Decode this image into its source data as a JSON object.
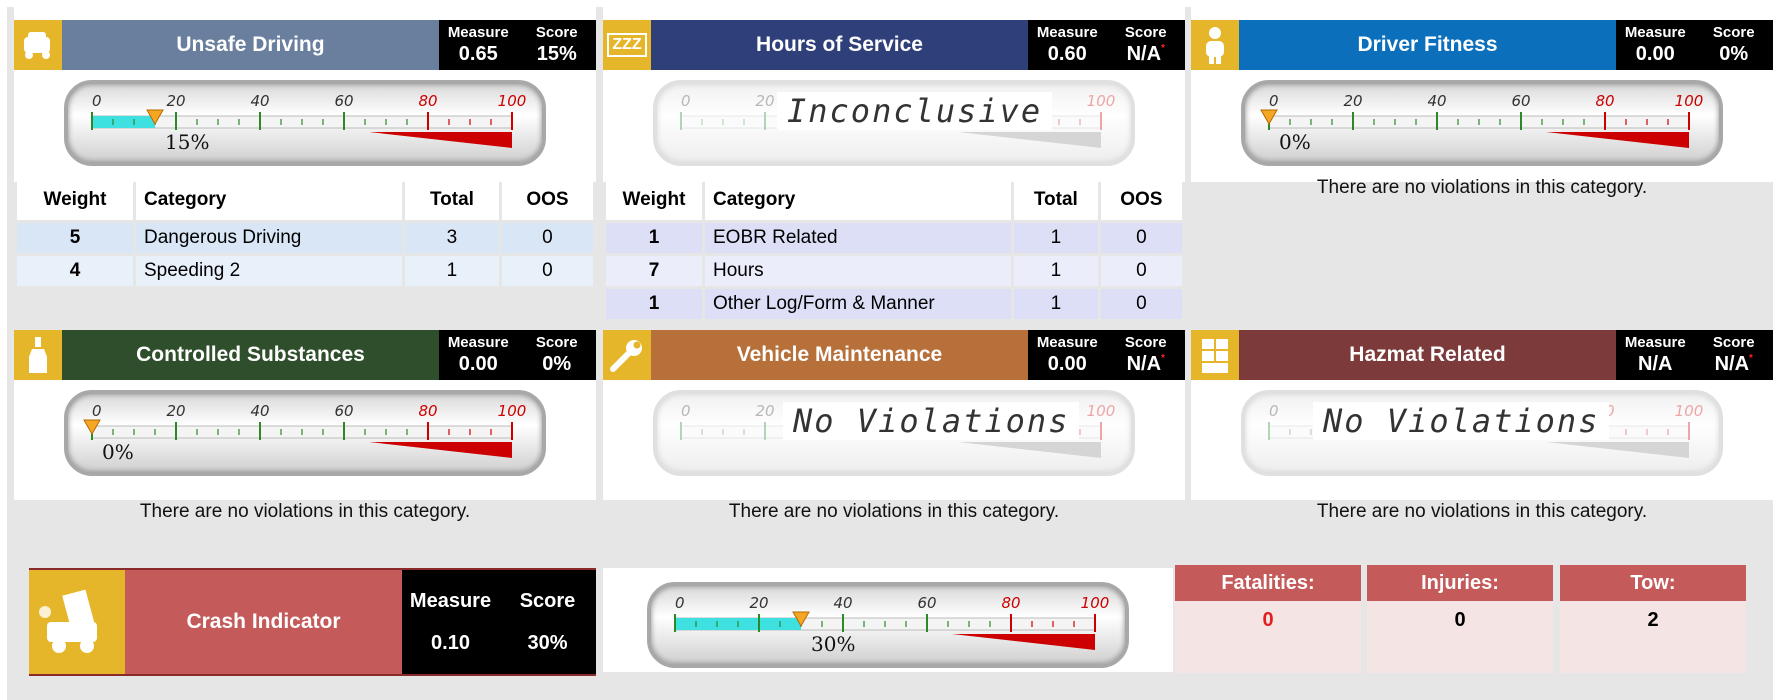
{
  "cards": {
    "unsafe_driving": {
      "title": "Unsafe Driving",
      "measure_label": "Measure",
      "measure": "0.65",
      "score_label": "Score",
      "score": "15%",
      "header_color": "#6a7f9e",
      "icon": "car-crash-icon",
      "gauge_value": 15,
      "gauge_readout": "15%"
    },
    "hours_of_service": {
      "title": "Hours of Service",
      "measure_label": "Measure",
      "measure": "0.60",
      "score_label": "Score",
      "score": "N/A",
      "score_marker": "*",
      "header_color": "#2f3f7a",
      "icon": "sleep-zzz-icon",
      "gauge_overlay": "Inconclusive"
    },
    "driver_fitness": {
      "title": "Driver Fitness",
      "measure_label": "Measure",
      "measure": "0.00",
      "score_label": "Score",
      "score": "0%",
      "header_color": "#0c6fbb",
      "icon": "person-icon",
      "gauge_value": 0,
      "gauge_readout": "0%"
    },
    "controlled_substances": {
      "title": "Controlled Substances",
      "measure_label": "Measure",
      "measure": "0.00",
      "score_label": "Score",
      "score": "0%",
      "header_color": "#2f4f2c",
      "icon": "bottle-icon",
      "gauge_value": 0,
      "gauge_readout": "0%"
    },
    "vehicle_maintenance": {
      "title": "Vehicle Maintenance",
      "measure_label": "Measure",
      "measure": "0.00",
      "score_label": "Score",
      "score": "N/A",
      "score_marker": "*",
      "header_color": "#b8703a",
      "icon": "wrench-icon",
      "gauge_overlay": "No Violations"
    },
    "hazmat_related": {
      "title": "Hazmat Related",
      "measure_label": "Measure",
      "measure": "N/A",
      "score_label": "Score",
      "score": "N/A",
      "score_marker": "*",
      "header_color": "#7d3a3a",
      "icon": "hazmat-boxes-icon",
      "gauge_overlay": "No Violations"
    },
    "crash_indicator": {
      "title": "Crash Indicator",
      "measure_label": "Measure",
      "measure": "0.10",
      "score_label": "Score",
      "score": "30%",
      "header_color": "#c45a5a",
      "icon": "truck-crash-icon",
      "gauge_value": 30,
      "gauge_readout": "30%"
    }
  },
  "gauge_ticks": [
    "0",
    "20",
    "40",
    "60",
    "80",
    "100"
  ],
  "table_headers": {
    "weight": "Weight",
    "category": "Category",
    "total": "Total",
    "oos": "OOS"
  },
  "unsafe_rows": [
    {
      "weight": "5",
      "category": "Dangerous Driving",
      "total": "3",
      "oos": "0"
    },
    {
      "weight": "4",
      "category": "Speeding 2",
      "total": "1",
      "oos": "0"
    }
  ],
  "hos_rows": [
    {
      "weight": "1",
      "category": "EOBR Related",
      "total": "1",
      "oos": "0"
    },
    {
      "weight": "7",
      "category": "Hours",
      "total": "1",
      "oos": "0"
    },
    {
      "weight": "1",
      "category": "Other Log/Form & Manner",
      "total": "1",
      "oos": "0"
    }
  ],
  "no_violations_note": "There are no violations in this category.",
  "crash_stats": {
    "fatalities_label": "Fatalities:",
    "fatalities": "0",
    "injuries_label": "Injuries:",
    "injuries": "0",
    "tow_label": "Tow:",
    "tow": "2"
  }
}
